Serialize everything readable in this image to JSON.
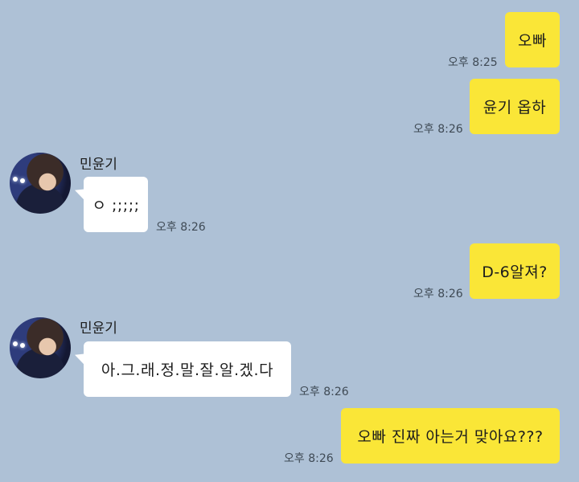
{
  "messages": [
    {
      "text": "오빠",
      "time": "오후 8:25"
    },
    {
      "text": "윤기 옵하",
      "time": "오후 8:26"
    },
    {
      "sender": "민윤기",
      "text": "ㅇ ;;;;;",
      "time": "오후 8:26"
    },
    {
      "text": "D-6알져?",
      "time": "오후 8:26"
    },
    {
      "sender": "민윤기",
      "text": "아.그.래.정.말.잘.알.겠.다",
      "time": "오후 8:26"
    },
    {
      "text": "오빠 진짜 아는거 맞아요???",
      "time": "오후 8:26"
    }
  ],
  "colors": {
    "background": "#aec1d6",
    "my_bubble": "#fae637",
    "their_bubble": "#ffffff"
  },
  "icons": {
    "avatar": "profile-avatar"
  }
}
